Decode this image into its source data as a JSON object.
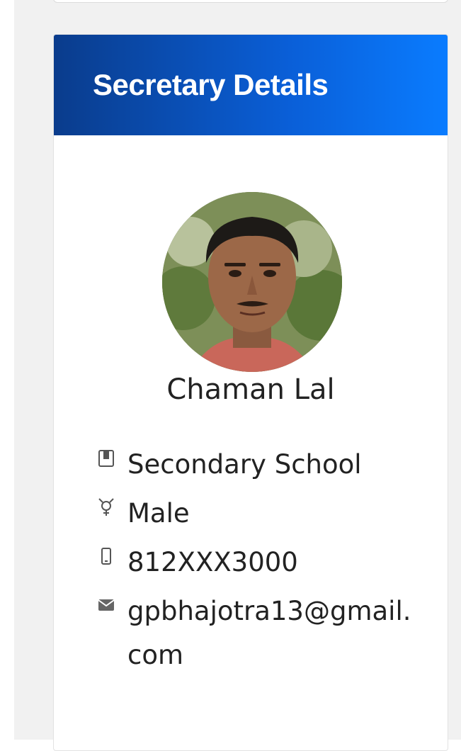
{
  "card": {
    "title": "Secretary Details"
  },
  "profile": {
    "name": "Chaman Lal"
  },
  "details": {
    "school": "Secondary School",
    "gender": "Male",
    "phone": "812XXX3000",
    "email": "gpbhajotra13@gmail.com"
  },
  "colors": {
    "header_start": "#0a3c8c",
    "header_end": "#0a7cff"
  },
  "icons": {
    "school": "book-icon",
    "gender": "gender-icon",
    "phone": "mobile-phone-icon",
    "email": "envelope-icon"
  }
}
